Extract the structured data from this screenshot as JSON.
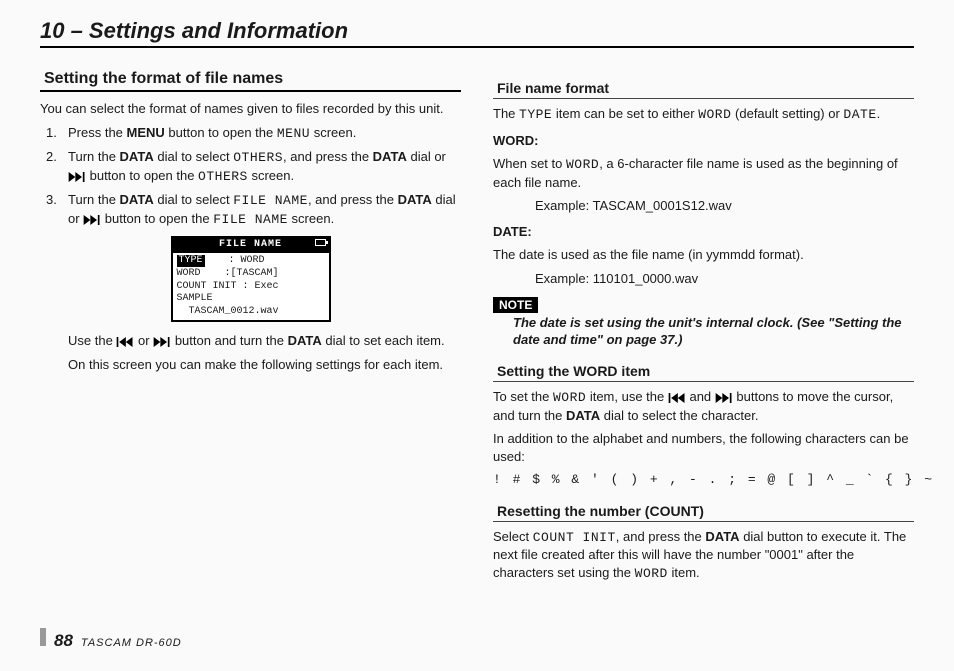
{
  "chapter_title": "10 – Settings and Information",
  "left": {
    "heading": "Setting the format of file names",
    "intro": "You can select the format of names given to files recorded by this unit.",
    "steps": [
      {
        "num": "1.",
        "pre": "Press the ",
        "b1": "MENU",
        "mid": " button to open the ",
        "mono1": "MENU",
        "post": " screen."
      },
      {
        "num": "2.",
        "pre": "Turn the ",
        "b1": "DATA",
        "mid": " dial to select ",
        "mono1": "OTHERS",
        "after_mono": ", and press the ",
        "b2": "DATA",
        "tail": " dial or ",
        "icon": "fwd",
        "tail2": " button to open the ",
        "mono2": "OTHERS",
        "end": " screen."
      },
      {
        "num": "3.",
        "pre": "Turn the ",
        "b1": "DATA",
        "mid": " dial to select ",
        "mono1": "FILE NAME",
        "after_mono": ", and press the ",
        "b2": "DATA",
        "tail": " dial or ",
        "icon": "fwd",
        "tail2": " button to open the ",
        "mono2": "FILE NAME",
        "end": " screen."
      }
    ],
    "lcd": {
      "title": "FILE NAME",
      "row1_label": "TYPE",
      "row1_val": ": WORD",
      "row2_label": "WORD",
      "row2_val": ":[TASCAM]",
      "row3": "COUNT INIT : Exec",
      "row4": "SAMPLE",
      "row5": "  TASCAM_0012.wav"
    },
    "after1_a": "Use the ",
    "after1_b": " or ",
    "after1_c": " button and turn the ",
    "after1_bold": "DATA",
    "after1_d": " dial to set each item.",
    "after2": "On this screen you can make the following settings for each item."
  },
  "right": {
    "h_format": "File name format",
    "format_p_a": "The ",
    "format_mono1": "TYPE",
    "format_p_b": " item can be set to either ",
    "format_mono2": "WORD",
    "format_p_c": " (default setting) or ",
    "format_mono3": "DATE",
    "format_p_d": ".",
    "word_label": "WORD:",
    "word_a": "When set to ",
    "word_mono": "WORD",
    "word_b": ", a 6-character file name is used as the beginning of each file name.",
    "word_ex": "Example: TASCAM_0001S12.wav",
    "date_label": "DATE:",
    "date_text": "The date is used as the file name (in yymmdd format).",
    "date_ex": "Example: 110101_0000.wav",
    "note_label": "NOTE",
    "note_text": "The date is set using the unit's internal clock. (See \"Setting the date and time\" on page 37.)",
    "h_word": "Setting the WORD item",
    "worditem_a": "To set the ",
    "worditem_mono": "WORD",
    "worditem_b": " item, use the ",
    "worditem_c": " and ",
    "worditem_d": " buttons to move the cursor, and turn the ",
    "worditem_bold": "DATA",
    "worditem_e": " dial to select the character.",
    "worditem_f": "In addition to the alphabet and numbers, the following characters can be used:",
    "chars": "! # $ % & ' ( ) + , - . ; = @ [ ] ^ _ ` { } ~",
    "h_reset": "Resetting the number (COUNT)",
    "reset_a": "Select ",
    "reset_mono1": "COUNT INIT",
    "reset_b": ", and press the ",
    "reset_bold": "DATA",
    "reset_c": " dial button to execute it. The next file created after this will have the number \"0001\" after the characters set using the ",
    "reset_mono2": "WORD",
    "reset_d": " item."
  },
  "footer": {
    "page": "88",
    "model": "TASCAM  DR-60D"
  }
}
